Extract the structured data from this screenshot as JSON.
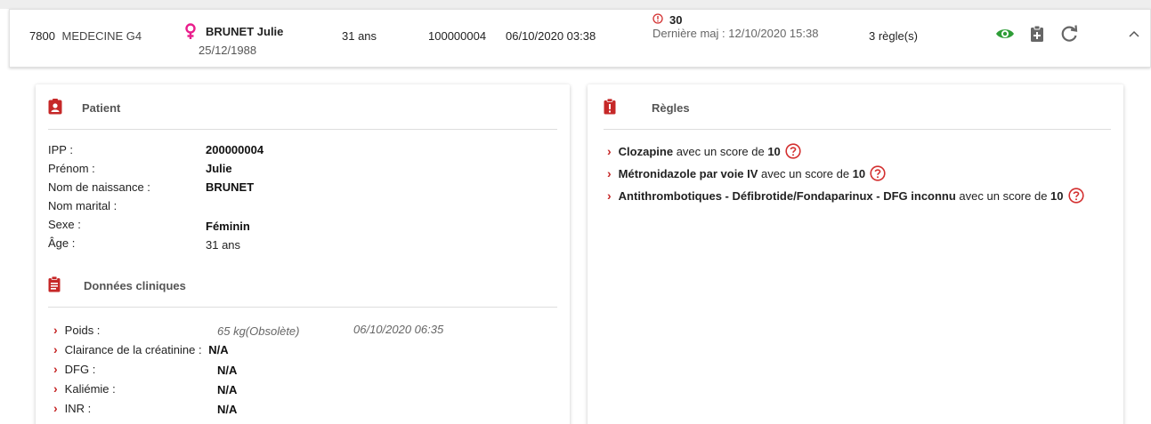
{
  "header": {
    "uf_code": "7800",
    "uf_name": "MEDECINE G4",
    "patient_name": "BRUNET Julie",
    "patient_dob": "25/12/1988",
    "age": "31 ans",
    "ipp": "100000004",
    "date": "06/10/2020 03:38",
    "score": "30",
    "last_update": "Dernière maj : 12/10/2020 15:38",
    "rules_count": "3 règle(s)",
    "colors": {
      "female": "#e91e8c",
      "alert": "#d32f2f",
      "eye": "#2e9d37",
      "icon_gray": "#666666"
    }
  },
  "patient_card": {
    "title": "Patient",
    "fields": [
      {
        "label": "IPP :",
        "value": "200000004",
        "bold": true
      },
      {
        "label": "Prénom :",
        "value": "Julie",
        "bold": true
      },
      {
        "label": "Nom de naissance :",
        "value": "BRUNET",
        "bold": true
      },
      {
        "label": "Nom marital :",
        "value": "",
        "bold": true
      },
      {
        "label": "Sexe :",
        "value": "Féminin",
        "bold": true
      },
      {
        "label": "Âge :",
        "value": "31 ans",
        "bold": false
      }
    ],
    "clinical_title": "Données cliniques",
    "clinical": [
      {
        "label": "Poids :",
        "value": "65 kg(Obsolète)",
        "date": "06/10/2020 06:35"
      },
      {
        "label": "Clairance de la créatinine :",
        "value": "N/A",
        "date": ""
      },
      {
        "label": "DFG :",
        "value": "N/A",
        "date": ""
      },
      {
        "label": "Kaliémie :",
        "value": "N/A",
        "date": ""
      },
      {
        "label": "INR :",
        "value": "N/A",
        "date": ""
      }
    ]
  },
  "rules_card": {
    "title": "Règles",
    "rules": [
      {
        "name": "Clozapine",
        "text": " avec un score de ",
        "score": "10"
      },
      {
        "name": "Métronidazole par voie IV",
        "text": " avec un score de ",
        "score": "10"
      },
      {
        "name": "Antithrombotiques - Défibrotide/Fondaparinux - DFG inconnu",
        "text": " avec un score de ",
        "score": "10"
      }
    ]
  }
}
